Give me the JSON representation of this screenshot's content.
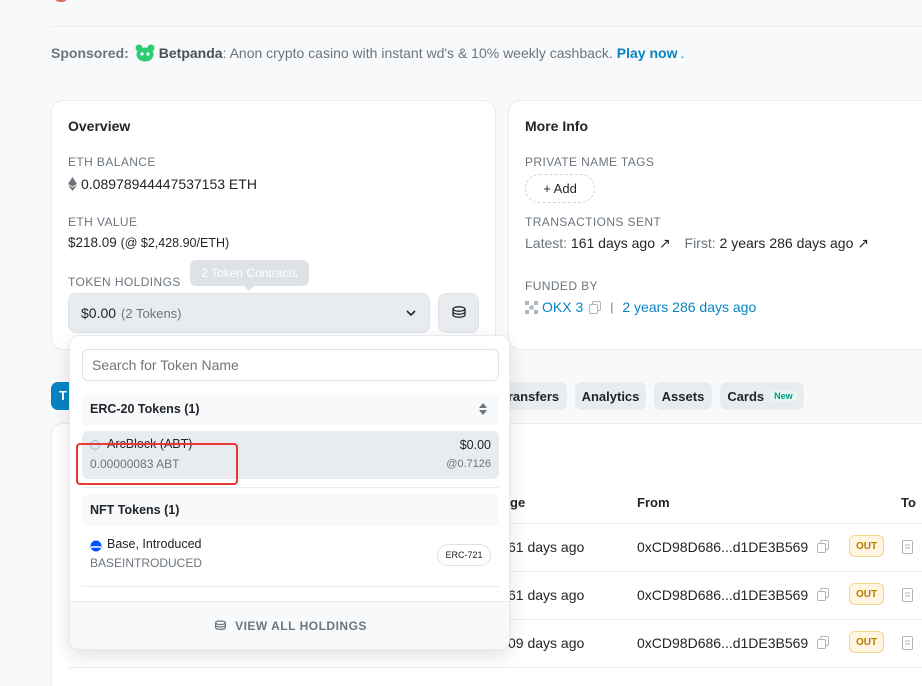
{
  "sponsored": {
    "label": "Sponsored:",
    "brand": "Betpanda",
    "text": ": Anon crypto casino with instant wd's & 10% weekly cashback.",
    "cta": "Play now",
    "dot": "."
  },
  "overview": {
    "title": "Overview",
    "eth_balance_label": "ETH BALANCE",
    "eth_balance": "0.08978944447537153 ETH",
    "eth_value_label": "ETH VALUE",
    "eth_value": "$218.09",
    "eth_value_rate": "(@ $2,428.90/ETH)",
    "token_holdings_label": "TOKEN HOLDINGS",
    "tooltip": "2 Token Contracts",
    "holdings_value": "$0.00",
    "holdings_count": "(2 Tokens)"
  },
  "more_info": {
    "title": "More Info",
    "private_tags_label": "PRIVATE NAME TAGS",
    "add_label": "+ Add",
    "tx_sent_label": "TRANSACTIONS SENT",
    "latest_label": "Latest:",
    "latest_value": "161 days ago",
    "first_label": "First:",
    "first_value": "2 years 286 days ago",
    "funded_by_label": "FUNDED BY",
    "funded_by": "OKX 3",
    "funded_sep": "|",
    "funded_time": "2 years 286 days ago"
  },
  "tabs": {
    "active_stub": "T",
    "transfers": "ransfers",
    "analytics": "Analytics",
    "assets": "Assets",
    "cards": "Cards",
    "new_badge": "New"
  },
  "table": {
    "col_age": "ge",
    "col_from": "From",
    "col_to": "To",
    "rows": [
      {
        "age": "61 days ago",
        "from": "0xCD98D686...d1DE3B569",
        "dir": "OUT"
      },
      {
        "age": "61 days ago",
        "from": "0xCD98D686...d1DE3B569",
        "dir": "OUT"
      },
      {
        "age": "09 days ago",
        "from": "0xCD98D686...d1DE3B569",
        "dir": "OUT"
      }
    ]
  },
  "dropdown": {
    "search_placeholder": "Search for Token Name",
    "erc20_header": "ERC-20 Tokens (1)",
    "erc20_items": [
      {
        "name": "ArcBlock (ABT)",
        "amount": "0.00000083 ABT",
        "value": "$0.00",
        "rate": "@0.7126"
      }
    ],
    "nft_header": "NFT Tokens (1)",
    "nft_items": [
      {
        "name": "Base, Introduced",
        "symbol": "BASEINTRODUCED",
        "standard": "ERC-721"
      }
    ],
    "view_all": "VIEW ALL HOLDINGS"
  },
  "colors": {
    "accent": "#0784c3",
    "highlight": "#e53935",
    "out_badge": "#b47d00"
  }
}
